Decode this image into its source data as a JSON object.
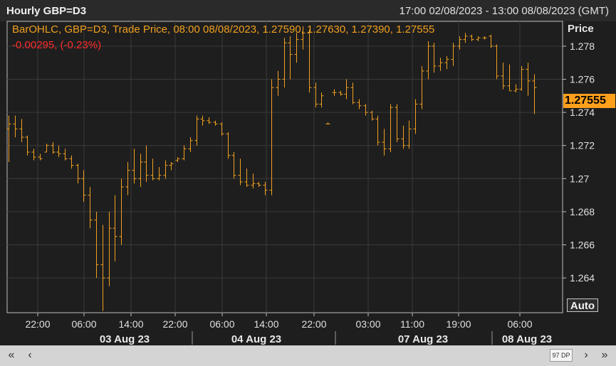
{
  "header": {
    "title": "Hourly GBP=D3",
    "range": "17:00 02/08/2023 - 13:00 08/08/2023 (GMT)"
  },
  "legend": {
    "line1": "BarOHLC, GBP=D3, Trade Price, 08:00 08/08/2023, 1.27590, 1.27630, 1.27390, 1.27555",
    "line2": "-0.00295, (-0.23%)"
  },
  "axis": {
    "y_title": "Price",
    "last_price": "1.27555",
    "auto_label": "Auto"
  },
  "footer": {
    "first_label": "«",
    "prev_label": "‹",
    "dp_label": "97 DP",
    "next_label": "›",
    "last_label": "»"
  },
  "colors": {
    "bars": "#f0a020",
    "background": "#1e1e1e",
    "grid": "#3a3a3a",
    "change_negative": "#ff2a2a",
    "last_price_badge": "#ffa01c"
  },
  "chart_data": {
    "type": "bar",
    "ohlc": true,
    "ylabel": "Price",
    "ylim": [
      1.2619,
      1.2795
    ],
    "yticks": [
      "1.264",
      "1.266",
      "1.268",
      "1.27",
      "1.272",
      "1.274",
      "1.276",
      "1.278"
    ],
    "xtick_labels": [
      "22:00",
      "06:00",
      "14:00",
      "22:00",
      "06:00",
      "14:00",
      "22:00",
      "03:00",
      "11:00",
      "19:00",
      "06:00"
    ],
    "date_labels": [
      "03 Aug 23",
      "04 Aug 23",
      "07 Aug 23",
      "08 Aug 23"
    ],
    "grid": true,
    "series": [
      {
        "values": [
          [
            1.273,
            1.2738,
            1.271,
            1.2733
          ],
          [
            1.2733,
            1.2738,
            1.2725,
            1.273
          ],
          [
            1.273,
            1.2736,
            1.2722,
            1.2725
          ],
          [
            1.2725,
            1.2726,
            1.2714,
            1.2716
          ],
          [
            1.2716,
            1.2718,
            1.2711,
            1.2713
          ],
          [
            1.2713,
            1.2715,
            1.2711,
            1.2712
          ],
          [
            1.2716,
            1.2721,
            1.2716,
            1.272
          ],
          [
            1.272,
            1.2722,
            1.2715,
            1.2716
          ],
          [
            1.2716,
            1.272,
            1.2713,
            1.2715
          ],
          [
            1.2715,
            1.2718,
            1.2711,
            1.2712
          ],
          [
            1.2712,
            1.2714,
            1.2706,
            1.2708
          ],
          [
            1.2708,
            1.2709,
            1.2697,
            1.27
          ],
          [
            1.27,
            1.2705,
            1.2686,
            1.269
          ],
          [
            1.269,
            1.2695,
            1.267,
            1.2675
          ],
          [
            1.2675,
            1.268,
            1.264,
            1.2648
          ],
          [
            1.2648,
            1.2672,
            1.262,
            1.264
          ],
          [
            1.264,
            1.268,
            1.2635,
            1.267
          ],
          [
            1.267,
            1.269,
            1.265,
            1.2665
          ],
          [
            1.2665,
            1.27,
            1.266,
            1.2695
          ],
          [
            1.2695,
            1.271,
            1.269,
            1.2705
          ],
          [
            1.2705,
            1.2718,
            1.2697,
            1.27
          ],
          [
            1.27,
            1.2715,
            1.2695,
            1.271
          ],
          [
            1.271,
            1.272,
            1.2698,
            1.2702
          ],
          [
            1.2702,
            1.2712,
            1.2699,
            1.27
          ],
          [
            1.27,
            1.2707,
            1.2699,
            1.2702
          ],
          [
            1.2702,
            1.2711,
            1.27,
            1.2708
          ],
          [
            1.2708,
            1.271,
            1.2705,
            1.2709
          ],
          [
            1.2711,
            1.2713,
            1.271,
            1.2712
          ],
          [
            1.2712,
            1.272,
            1.2711,
            1.2718
          ],
          [
            1.2718,
            1.2725,
            1.2716,
            1.2723
          ],
          [
            1.2723,
            1.2738,
            1.272,
            1.2736
          ],
          [
            1.2736,
            1.2738,
            1.2732,
            1.2735
          ],
          [
            1.2735,
            1.2737,
            1.2733,
            1.2734
          ],
          [
            1.2734,
            1.2735,
            1.2732,
            1.2733
          ],
          [
            1.2733,
            1.2734,
            1.2726,
            1.2727
          ],
          [
            1.2727,
            1.2728,
            1.2712,
            1.2714
          ],
          [
            1.2714,
            1.2716,
            1.27,
            1.2702
          ],
          [
            1.2702,
            1.2712,
            1.2696,
            1.2698
          ],
          [
            1.2698,
            1.2706,
            1.2695,
            1.2696
          ],
          [
            1.2696,
            1.2703,
            1.2694,
            1.2697
          ],
          [
            1.2697,
            1.2698,
            1.2695,
            1.2696
          ],
          [
            1.2696,
            1.2698,
            1.269,
            1.2693
          ],
          [
            1.2693,
            1.276,
            1.269,
            1.2755
          ],
          [
            1.2755,
            1.2765,
            1.275,
            1.276
          ],
          [
            1.276,
            1.2785,
            1.2755,
            1.2782
          ],
          [
            1.2782,
            1.2786,
            1.276,
            1.2775
          ],
          [
            1.2775,
            1.2788,
            1.277,
            1.2784
          ],
          [
            1.2784,
            1.2792,
            1.2778,
            1.2788
          ],
          [
            1.2788,
            1.279,
            1.2752,
            1.2755
          ],
          [
            1.2755,
            1.2758,
            1.2743,
            1.2745
          ],
          [
            1.2745,
            1.2752,
            1.2743,
            1.275
          ],
          [
            1.2733,
            1.2734,
            1.2733,
            1.2733
          ],
          [
            1.2752,
            1.2754,
            1.275,
            1.2752
          ],
          [
            1.2752,
            1.2753,
            1.275,
            1.2751
          ],
          [
            1.2751,
            1.276,
            1.2748,
            1.2755
          ],
          [
            1.2755,
            1.2758,
            1.2745,
            1.2746
          ],
          [
            1.2746,
            1.2748,
            1.2742,
            1.2744
          ],
          [
            1.2744,
            1.2745,
            1.2738,
            1.274
          ],
          [
            1.274,
            1.2741,
            1.2735,
            1.2736
          ],
          [
            1.2736,
            1.2738,
            1.272,
            1.2722
          ],
          [
            1.2722,
            1.273,
            1.2714,
            1.2718
          ],
          [
            1.2718,
            1.2745,
            1.2716,
            1.2743
          ],
          [
            1.2743,
            1.2745,
            1.2722,
            1.2724
          ],
          [
            1.2724,
            1.2732,
            1.2718,
            1.272
          ],
          [
            1.272,
            1.2735,
            1.2718,
            1.273
          ],
          [
            1.273,
            1.2748,
            1.2727,
            1.2745
          ],
          [
            1.2745,
            1.2768,
            1.2742,
            1.2765
          ],
          [
            1.2765,
            1.2783,
            1.276,
            1.278
          ],
          [
            1.278,
            1.2782,
            1.2764,
            1.2768
          ],
          [
            1.2768,
            1.2773,
            1.2765,
            1.277
          ],
          [
            1.277,
            1.2774,
            1.2766,
            1.2772
          ],
          [
            1.2772,
            1.2782,
            1.2768,
            1.278
          ],
          [
            1.278,
            1.2786,
            1.2778,
            1.2784
          ],
          [
            1.2784,
            1.2788,
            1.2782,
            1.2786
          ],
          [
            1.2786,
            1.2787,
            1.2783,
            1.2784
          ],
          [
            1.2784,
            1.2786,
            1.2783,
            1.2785
          ],
          [
            1.2785,
            1.2786,
            1.2784,
            1.2785
          ],
          [
            1.2786,
            1.2787,
            1.2779,
            1.278
          ],
          [
            1.278,
            1.2781,
            1.276,
            1.2762
          ],
          [
            1.2762,
            1.277,
            1.2754,
            1.2756
          ],
          [
            1.2756,
            1.2769,
            1.2753,
            1.2753
          ],
          [
            1.2753,
            1.2757,
            1.2752,
            1.2754
          ],
          [
            1.2754,
            1.2768,
            1.2753,
            1.2766
          ],
          [
            1.2766,
            1.277,
            1.275,
            1.2759
          ],
          [
            1.2759,
            1.2763,
            1.2739,
            1.2755
          ]
        ]
      }
    ]
  }
}
